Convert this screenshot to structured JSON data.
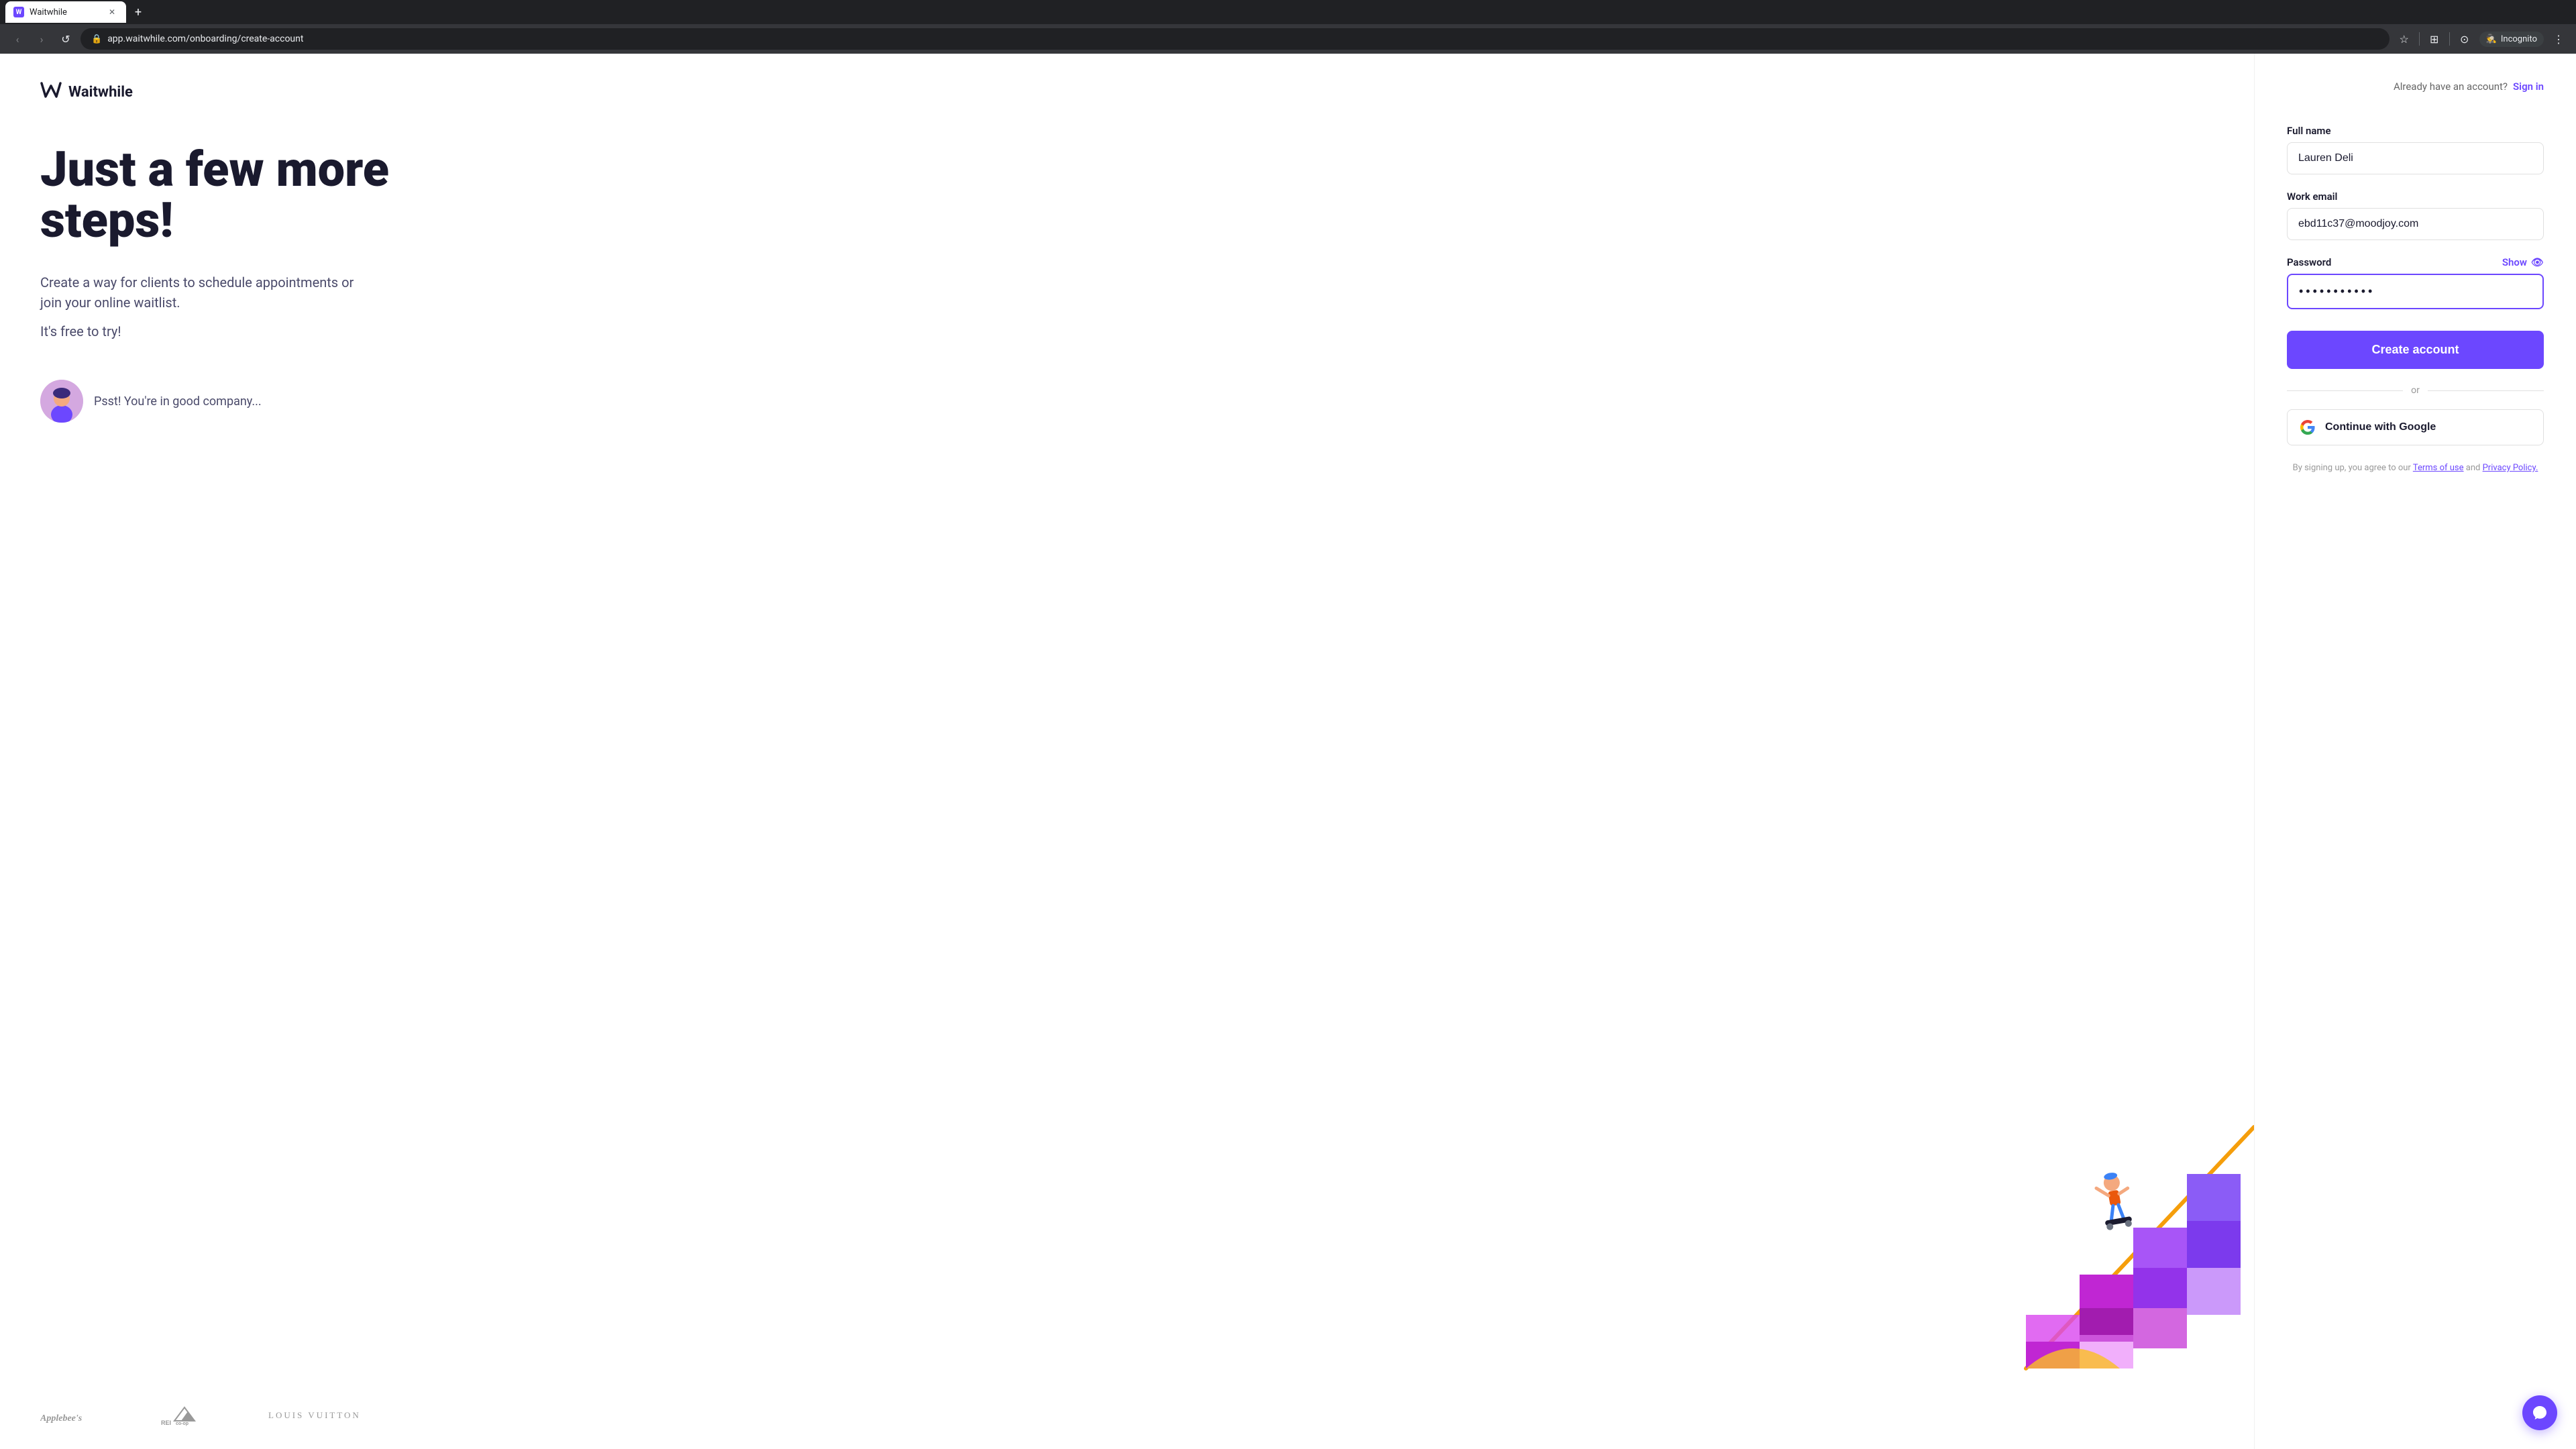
{
  "browser": {
    "tab_label": "Waitwhile",
    "tab_favicon": "W",
    "address": "app.waitwhile.com/onboarding/create-account",
    "incognito_label": "Incognito",
    "new_tab_symbol": "+",
    "nav": {
      "back": "‹",
      "forward": "›",
      "reload": "↺"
    }
  },
  "page": {
    "logo": {
      "icon": "W",
      "text": "Waitwhile"
    },
    "hero": {
      "title": "Just a few more steps!",
      "subtitle": "Create a way for clients to schedule appointments or join your online waitlist.",
      "free_text": "It's free to try!"
    },
    "testimonial": {
      "text": "Psst! You're in good company..."
    },
    "brands": [
      {
        "name": "Applebee's",
        "class": "applebees"
      },
      {
        "name": "REI co-op",
        "class": "rei"
      },
      {
        "name": "LOUIS VUITTON",
        "class": "lv"
      }
    ],
    "form": {
      "already_account": "Already have an account?",
      "sign_in": "Sign in",
      "full_name_label": "Full name",
      "full_name_value": "Lauren Deli",
      "full_name_placeholder": "Lauren Deli",
      "work_email_label": "Work email",
      "work_email_value": "ebd11c37@moodjoy.com",
      "work_email_placeholder": "ebd11c37@moodjoy.com",
      "password_label": "Password",
      "password_show": "Show",
      "password_value": "············",
      "create_account_label": "Create account",
      "or_text": "or",
      "google_label": "Continue with Google",
      "terms_text": "By signing up, you agree to our",
      "terms_link": "Terms of use",
      "and_text": "and",
      "privacy_link": "Privacy Policy."
    }
  },
  "icons": {
    "eye_icon": "👁",
    "chat_icon": "💬",
    "star_icon": "☆",
    "extensions_icon": "⊞",
    "profile_icon": "⊙",
    "menu_icon": "⋮"
  }
}
